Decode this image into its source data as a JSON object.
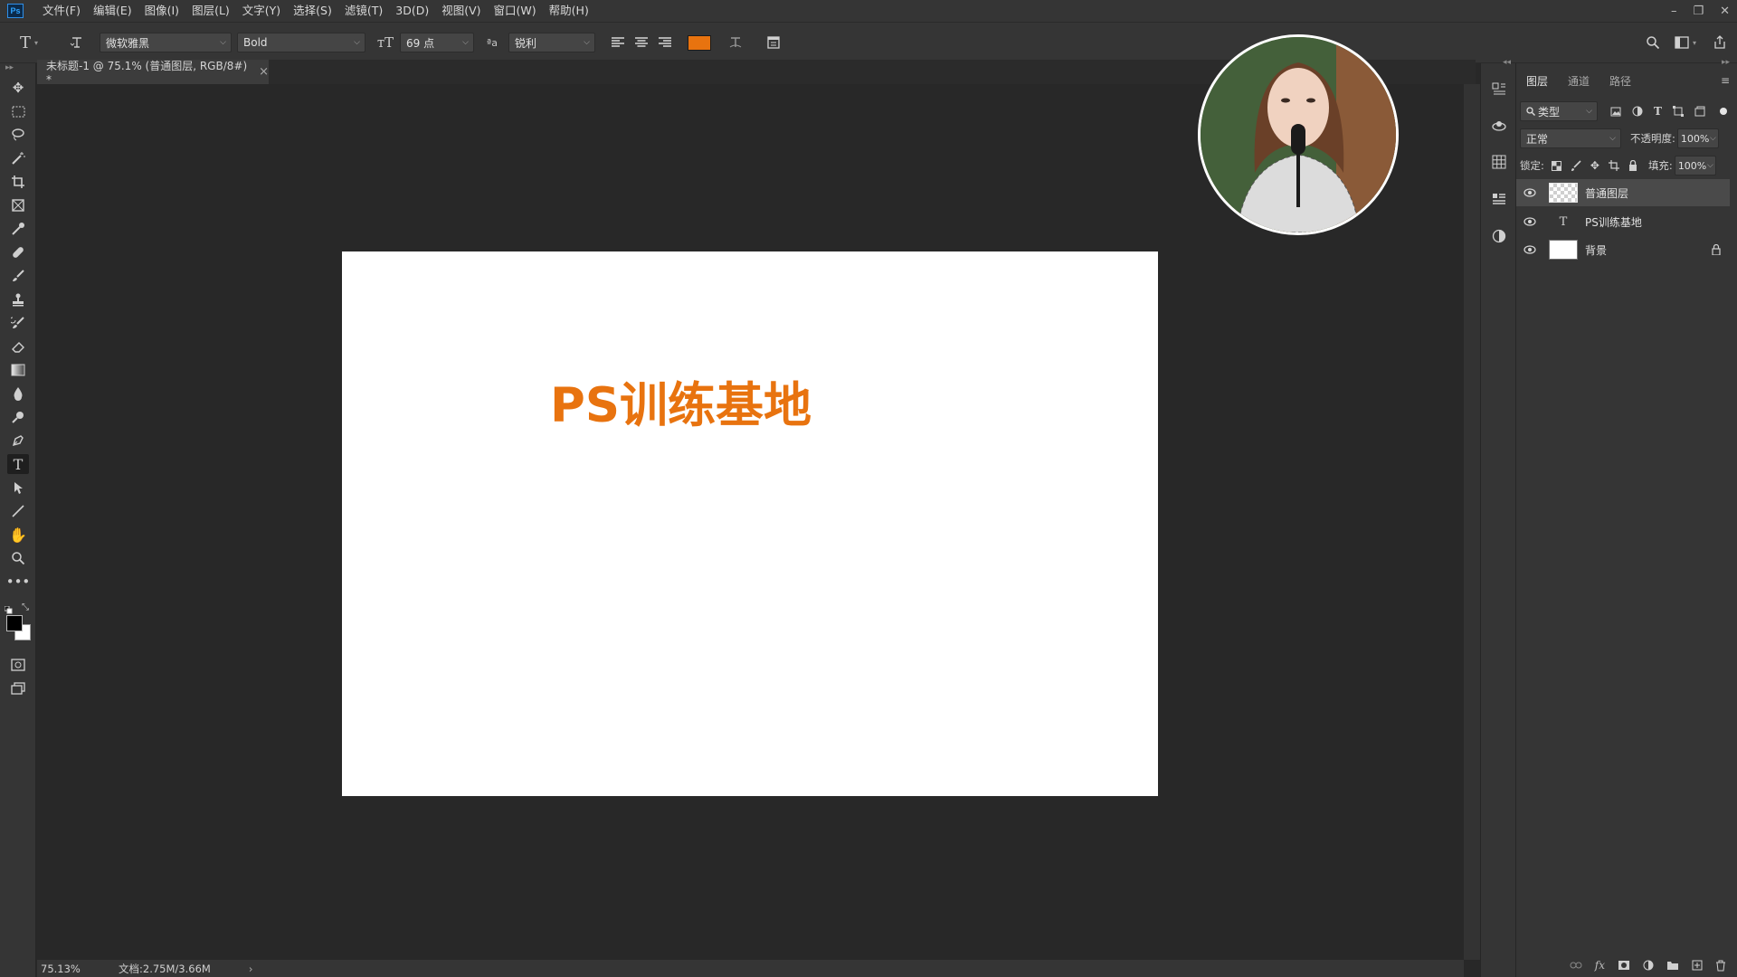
{
  "app": {
    "logo": "Ps"
  },
  "menu": [
    "文件(F)",
    "编辑(E)",
    "图像(I)",
    "图层(L)",
    "文字(Y)",
    "选择(S)",
    "滤镜(T)",
    "3D(D)",
    "视图(V)",
    "窗口(W)",
    "帮助(H)"
  ],
  "window_controls": {
    "minimize": "–",
    "restore": "❐",
    "close": "✕"
  },
  "options": {
    "font_family": "微软雅黑",
    "font_style": "Bold",
    "font_size": "69 点",
    "antialias": "锐利",
    "text_color": "#e8730f"
  },
  "document": {
    "tab_title": "未标题-1 @ 75.1% (普通图层, RGB/8#) *",
    "tab_close": "×",
    "canvas_text": "PS训练基地",
    "canvas_text_color": "#e8730f"
  },
  "status": {
    "zoom": "75.13%",
    "doc_size": "文档:2.75M/3.66M",
    "arrow": "›"
  },
  "layers_panel": {
    "tabs": [
      "图层",
      "通道",
      "路径"
    ],
    "filter_label": "类型",
    "blend_mode": "正常",
    "opacity_label": "不透明度:",
    "opacity_value": "100%",
    "lock_label": "锁定:",
    "fill_label": "填充:",
    "fill_value": "100%",
    "layers": [
      {
        "name": "普通图层",
        "selected": true
      },
      {
        "name": "PS训练基地",
        "selected": false
      },
      {
        "name": "背景",
        "selected": false,
        "locked": true
      }
    ]
  }
}
